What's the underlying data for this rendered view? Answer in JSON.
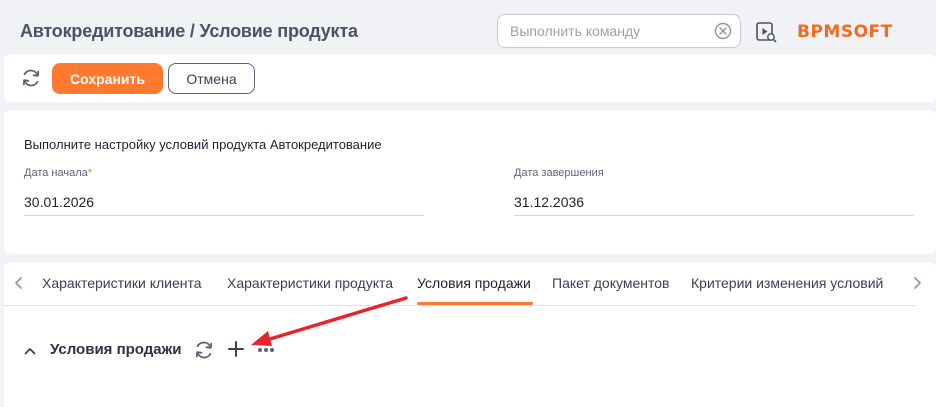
{
  "header": {
    "title": "Автокредитование / Условие продукта",
    "command_placeholder": "Выполнить команду",
    "logo_text": "BPMSOFT"
  },
  "toolbar": {
    "save_label": "Сохранить",
    "cancel_label": "Отмена"
  },
  "info": {
    "description": "Выполните настройку условий продукта Автокредитование",
    "start_label": "Дата начала",
    "start_required_mark": "*",
    "start_value": "30.01.2026",
    "end_label": "Дата завершения",
    "end_value": "31.12.2036"
  },
  "tabs": [
    {
      "label": "Характеристики клиента"
    },
    {
      "label": "Характеристики продукта"
    },
    {
      "label": "Условия продажи"
    },
    {
      "label": "Пакет документов"
    },
    {
      "label": "Критерии изменения условий"
    }
  ],
  "active_tab": "Условия продажи",
  "section": {
    "title": "Условия продажи"
  },
  "colors": {
    "accent": "#ff7a2f",
    "background": "#f0f2f5",
    "annotation_arrow": "#e8232a"
  },
  "icons": [
    "refresh-icon",
    "clear-icon",
    "help-video-icon",
    "chevron-left-icon",
    "chevron-right-icon",
    "chevron-up-icon",
    "plus-icon",
    "more-icon"
  ]
}
